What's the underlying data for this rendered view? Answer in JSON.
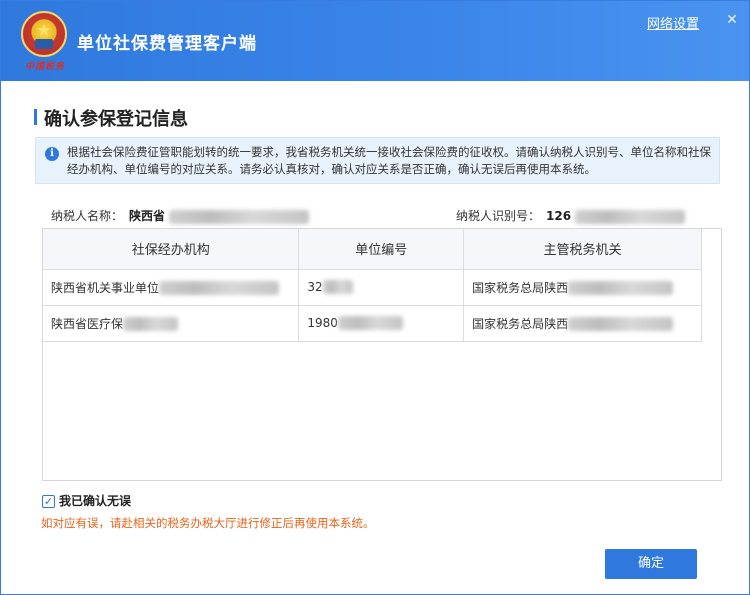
{
  "window": {
    "title": "单位社保费管理客户端",
    "logo_text": "中国税务",
    "network_link": "网络设置",
    "close_icon": "close-icon"
  },
  "section": {
    "title": "确认参保登记信息"
  },
  "notice": {
    "icon": "info-icon",
    "text": "根据社会保险费征管职能划转的统一要求，我省税务机关统一接收社会保险费的征收权。请确认纳税人识别号、单位名称和社保经办机构、单位编号的对应关系。请务必认真核对，确认对应关系是否正确，确认无误后再使用本系统。"
  },
  "taxpayer": {
    "name_label": "纳税人名称：",
    "name_value": "陕西省",
    "id_label": "纳税人识别号：",
    "id_value": "126"
  },
  "table": {
    "headers": [
      "社保经办机构",
      "单位编号",
      "主管税务机关"
    ],
    "rows": [
      [
        "陕西省机关事业单位",
        "32",
        "国家税务总局陕西"
      ],
      [
        "陕西省医疗保",
        "1980",
        "国家税务总局陕西"
      ]
    ]
  },
  "confirm": {
    "label": "我已确认无误",
    "checked": true
  },
  "warning": "如对应有误，请赴相关的税务办税大厅进行修正后再使用本系统。",
  "ok_button": "确定",
  "colors": {
    "accent": "#2f79de",
    "warning": "#e8631b"
  }
}
